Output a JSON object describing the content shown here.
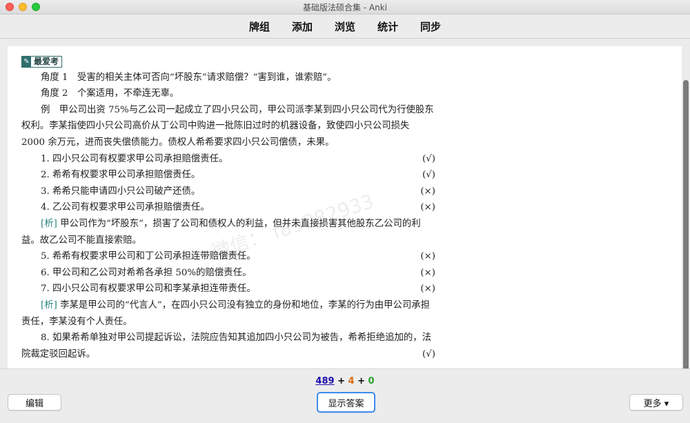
{
  "window": {
    "title": "基础版法硕合集 - Anki"
  },
  "toolbar": {
    "items": [
      "牌组",
      "添加",
      "浏览",
      "统计",
      "同步"
    ]
  },
  "card": {
    "tag_label": "最爱考",
    "lines": [
      "角度 1　受害的相关主体可否向“坏股东”请求赔偿？“害到谁，谁索赔”。",
      "角度 2　个案适用，不牵连无辜。"
    ],
    "example": "例　甲公司出资 75%与乙公司一起成立了四小只公司，甲公司派李某到四小只公司代为行使股东权利。李某指使四小只公司高价从丁公司中购进一批陈旧过时的机器设备，致使四小只公司损失 2000 余万元，进而丧失偿债能力。债权人希希要求四小只公司偿债，未果。",
    "items1": [
      {
        "text": "1. 四小只公司有权要求甲公司承担赔偿责任。",
        "mark": "(√)"
      },
      {
        "text": "2. 希希有权要求甲公司承担赔偿责任。",
        "mark": "(√)"
      },
      {
        "text": "3. 希希只能申请四小只公司破产还债。",
        "mark": "(×)"
      },
      {
        "text": "4. 乙公司有权要求甲公司承担赔偿责任。",
        "mark": "(×)"
      }
    ],
    "analysis1_label": "[析]",
    "analysis1": "甲公司作为“坏股东”，损害了公司和债权人的利益，但并未直接损害其他股东乙公司的利益。故乙公司不能直接索赔。",
    "items2": [
      {
        "text": "5. 希希有权要求甲公司和丁公司承担连带赔偿责任。",
        "mark": "(×)"
      },
      {
        "text": "6. 甲公司和乙公司对希希各承担 50%的赔偿责任。",
        "mark": "(×)"
      },
      {
        "text": "7. 四小只公司有权要求甲公司和李某承担连带责任。",
        "mark": "(×)"
      }
    ],
    "analysis2_label": "[析]",
    "analysis2": "李某是甲公司的“代言人”，在四小只公司没有独立的身份和地位，李某的行为由甲公司承担责任，李某没有个人责任。",
    "item8": {
      "text": "8. 如果希希单独对甲公司提起诉讼，法院应告知其追加四小只公司为被告，希希拒绝追加的，法院裁定驳回起诉。",
      "mark": "(√)"
    },
    "watermark": "微信： f89082933"
  },
  "counts": {
    "new": "489",
    "plus1": "+",
    "learning": "4",
    "plus2": "+",
    "review": "0"
  },
  "buttons": {
    "edit": "编辑",
    "show_answer": "显示答案",
    "more": "更多 ▾"
  },
  "colors": {
    "new": "#1a0dab",
    "learning": "#d96a10",
    "review": "#2b9e2b",
    "focus": "#3f8bf0"
  }
}
